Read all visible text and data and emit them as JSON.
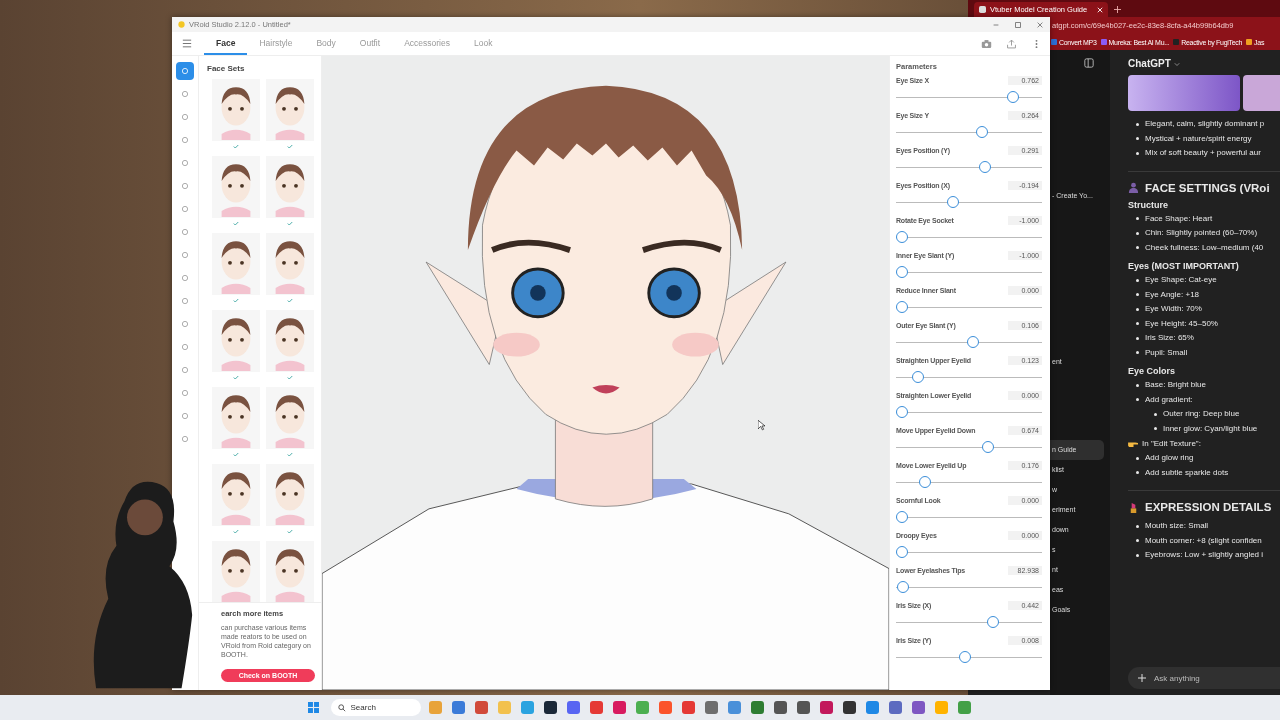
{
  "vroid": {
    "title": "VRoid Studio 2.12.0 - Untitled*",
    "tabs": [
      {
        "label": "Face",
        "selected": true
      },
      {
        "label": "Hairstyle",
        "selected": false
      },
      {
        "label": "Body",
        "selected": false
      },
      {
        "label": "Outfit",
        "selected": false
      },
      {
        "label": "Accessories",
        "selected": false
      },
      {
        "label": "Look",
        "selected": false
      }
    ],
    "categories": [
      {
        "selected": true
      },
      {
        "selected": false
      },
      {
        "selected": false
      },
      {
        "selected": false
      },
      {
        "selected": false
      },
      {
        "selected": false
      },
      {
        "selected": false
      },
      {
        "selected": false
      },
      {
        "selected": false
      },
      {
        "selected": false
      },
      {
        "selected": false
      },
      {
        "selected": false
      },
      {
        "selected": false
      },
      {
        "selected": false
      },
      {
        "selected": false
      },
      {
        "selected": false
      },
      {
        "selected": false
      }
    ],
    "face_sets": {
      "title": "Face Sets",
      "thumbnails": [
        {
          "checked": true
        },
        {
          "checked": true
        },
        {
          "checked": true
        },
        {
          "checked": true
        },
        {
          "checked": true
        },
        {
          "checked": true
        },
        {
          "checked": true
        },
        {
          "checked": true
        },
        {
          "checked": true
        },
        {
          "checked": true
        },
        {
          "checked": true
        },
        {
          "checked": true
        },
        {
          "checked": false
        },
        {
          "checked": false
        }
      ],
      "more_title": "earch more items",
      "more_text": "can purchase various items made reators to be used on VRoid from Roid category on BOOTH.",
      "booth_button": "Check on BOOTH"
    },
    "parameters": {
      "title": "Parameters",
      "sliders": [
        {
          "label": "Eye Size X",
          "value": "0.762",
          "level": 0.83
        },
        {
          "label": "Eye Size Y",
          "value": "0.264",
          "level": 0.6
        },
        {
          "label": "Eyes Position (Y)",
          "value": "0.291",
          "level": 0.62
        },
        {
          "label": "Eyes Position (X)",
          "value": "-0.194",
          "level": 0.38
        },
        {
          "label": "Rotate Eye Socket",
          "value": "-1.000",
          "level": 0
        },
        {
          "label": "Inner Eye Slant (Y)",
          "value": "-1.000",
          "level": 0
        },
        {
          "label": "Reduce Inner Slant",
          "value": "0.000",
          "level": 0
        },
        {
          "label": "Outer Eye Slant (Y)",
          "value": "0.106",
          "level": 0.53
        },
        {
          "label": "Straighten Upper Eyelid",
          "value": "0.123",
          "level": 0.12
        },
        {
          "label": "Straighten Lower Eyelid",
          "value": "0.000",
          "level": 0
        },
        {
          "label": "Move Upper Eyelid Down",
          "value": "0.674",
          "level": 0.64
        },
        {
          "label": "Move Lower Eyelid Up",
          "value": "0.176",
          "level": 0.17
        },
        {
          "label": "Scornful Look",
          "value": "0.000",
          "level": 0
        },
        {
          "label": "Droopy Eyes",
          "value": "0.000",
          "level": 0
        },
        {
          "label": "Lower Eyelashes Tips",
          "value": "82.938",
          "level": 0.01
        },
        {
          "label": "Iris Size (X)",
          "value": "0.442",
          "level": 0.68
        },
        {
          "label": "Iris Size (Y)",
          "value": "0.008",
          "level": 0.47
        }
      ]
    }
  },
  "browser": {
    "tab": "Vtuber Model Creation Guide",
    "address": "atgpt.com/c/69e4b027-ee2c-83e8-8cfa-a44b99b64db9",
    "bookmarks": [
      {
        "label": "Convert MP3",
        "color": "#2f6fd6"
      },
      {
        "label": "Mureka: Best AI Mu...",
        "color": "#8b5cf6"
      },
      {
        "label": "Reactive by FugiTech",
        "color": "#222222"
      },
      {
        "label": "Jas",
        "color": "#f0a020"
      }
    ],
    "sidebar": [
      {
        "label": "- Create Yo...",
        "selected": false
      },
      {
        "label": "ent",
        "selected": false
      },
      {
        "label": "n Guide",
        "selected": true
      },
      {
        "label": "klist",
        "selected": false
      },
      {
        "label": "w",
        "selected": false
      },
      {
        "label": "eriment",
        "selected": false
      },
      {
        "label": "down",
        "selected": false
      },
      {
        "label": "s",
        "selected": false
      },
      {
        "label": "nt",
        "selected": false
      },
      {
        "label": "eas",
        "selected": false
      },
      {
        "label": "Goals",
        "selected": false
      }
    ],
    "chat_title": "ChatGPT",
    "blocks": [
      {
        "kind": "image"
      },
      {
        "kind": "bullets",
        "items": [
          {
            "text": "Elegant, calm, slightly dominant p"
          },
          {
            "text": "Mystical + nature/spirit energy"
          },
          {
            "text": "Mix of soft beauty + powerful aur"
          }
        ]
      },
      {
        "kind": "rule"
      },
      {
        "kind": "heading",
        "text": "FACE SETTINGS (VRoi"
      },
      {
        "kind": "subheading",
        "text": "Structure"
      },
      {
        "kind": "bullets",
        "items": [
          {
            "text": "Face Shape: Heart"
          },
          {
            "text": "Chin: Slightly pointed (60–70%)"
          },
          {
            "text": "Cheek fullness: Low–medium (40"
          }
        ]
      },
      {
        "kind": "subheading",
        "text": "Eyes (MOST IMPORTANT)"
      },
      {
        "kind": "bullets",
        "items": [
          {
            "text": "Eye Shape: Cat-eye"
          },
          {
            "text": "Eye Angle: +18"
          },
          {
            "text": "Eye Width: 70%"
          },
          {
            "text": "Eye Height: 45–50%"
          },
          {
            "text": "Iris Size: 65%"
          },
          {
            "text": "Pupil: Small"
          }
        ]
      },
      {
        "kind": "subheading",
        "text": "Eye Colors"
      },
      {
        "kind": "bullets",
        "items": [
          {
            "text": "Base: Bright blue"
          },
          {
            "text": "Add gradient:",
            "children": [
              {
                "text": "Outer ring: Deep blue"
              },
              {
                "text": "Inner glow: Cyan/light blue"
              }
            ]
          }
        ]
      },
      {
        "kind": "note",
        "text": "In \"Edit Texture\":"
      },
      {
        "kind": "bullets",
        "items": [
          {
            "text": "Add glow ring"
          },
          {
            "text": "Add subtle sparkle dots"
          }
        ]
      },
      {
        "kind": "rule"
      },
      {
        "kind": "heading",
        "text": "EXPRESSION DETAILS"
      },
      {
        "kind": "bullets",
        "items": [
          {
            "text": "Mouth size: Small"
          },
          {
            "text": "Mouth corner: +8 (slight confiden"
          },
          {
            "text": "Eyebrows: Low + slightly angled i"
          }
        ]
      }
    ],
    "prompt": {
      "placeholder": "Ask anything"
    }
  },
  "taskbar": {
    "search": {
      "placeholder": "Search"
    },
    "apps": [
      {
        "color": "#e8a33a"
      },
      {
        "color": "#3b7bd8"
      },
      {
        "color": "#d14a3a"
      },
      {
        "color": "#f2c14e"
      },
      {
        "color": "#2aa3e0"
      },
      {
        "color": "#1b2838"
      },
      {
        "color": "#5865f2"
      },
      {
        "color": "#e53935"
      },
      {
        "color": "#d81b60"
      },
      {
        "color": "#4caf50"
      },
      {
        "color": "#fb542b"
      },
      {
        "color": "#e53935"
      },
      {
        "color": "#6e6e6e"
      },
      {
        "color": "#4a90d9"
      },
      {
        "color": "#2e7d32"
      },
      {
        "color": "#555555"
      },
      {
        "color": "#555555"
      },
      {
        "color": "#c2185b"
      },
      {
        "color": "#333333"
      },
      {
        "color": "#1e88e5"
      },
      {
        "color": "#5c6bc0"
      },
      {
        "color": "#7e57c2"
      },
      {
        "color": "#ffb300"
      },
      {
        "color": "#43a047"
      }
    ]
  }
}
